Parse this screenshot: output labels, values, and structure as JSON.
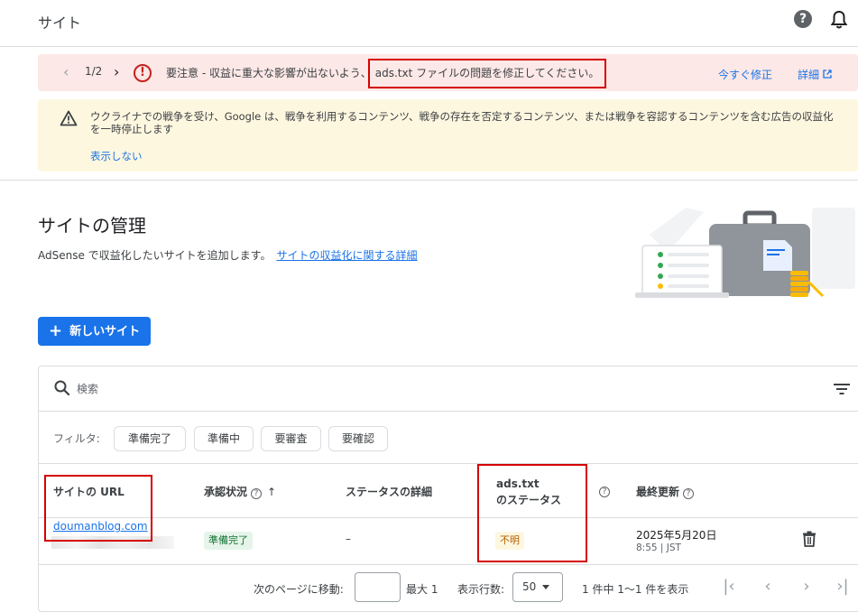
{
  "header": {
    "title": "サイト"
  },
  "alert_pink": {
    "pager": "1/2",
    "message_before": "要注意 - 収益に重大な影響が出ないよう、",
    "message_highlight": "ads.txt ファイルの問題を修正してください。",
    "fix_label": "今すぐ修正",
    "detail_label": "詳細"
  },
  "alert_yellow": {
    "message": "ウクライナでの戦争を受け、Google は、戦争を利用するコンテンツ、戦争の存在を否定するコンテンツ、または戦争を容認するコンテンツを含む広告の収益化を一時停止します",
    "dismiss_label": "表示しない"
  },
  "page": {
    "title": "サイトの管理",
    "description": "AdSense で収益化したいサイトを追加します。",
    "learn_link": "サイトの収益化に関する詳細",
    "new_site_label": "新しいサイト"
  },
  "table": {
    "search_placeholder": "検索",
    "filter_label": "フィルタ:",
    "chips": [
      "準備完了",
      "準備中",
      "要審査",
      "要確認"
    ],
    "columns": {
      "site_url": "サイトの URL",
      "approval": "承認状況",
      "status_detail": "ステータスの詳細",
      "ads_line1": "ads.txt",
      "ads_line2": "のステータス",
      "last_updated": "最終更新"
    },
    "rows": [
      {
        "url": "doumanblog.com",
        "approval": "準備完了",
        "status_detail": "–",
        "ads_status": "不明",
        "date": "2025年5月20日",
        "time": "8:55 | JST"
      }
    ]
  },
  "footer": {
    "goto_label": "次のページに移動:",
    "max_label": "最大 1",
    "rows_label": "表示行数:",
    "rows_value": "50",
    "count_label": "1 件中 1〜1 件を表示"
  },
  "colors": {
    "primary": "#1a73e8",
    "error": "#c5221f",
    "annotation": "#d50000"
  }
}
